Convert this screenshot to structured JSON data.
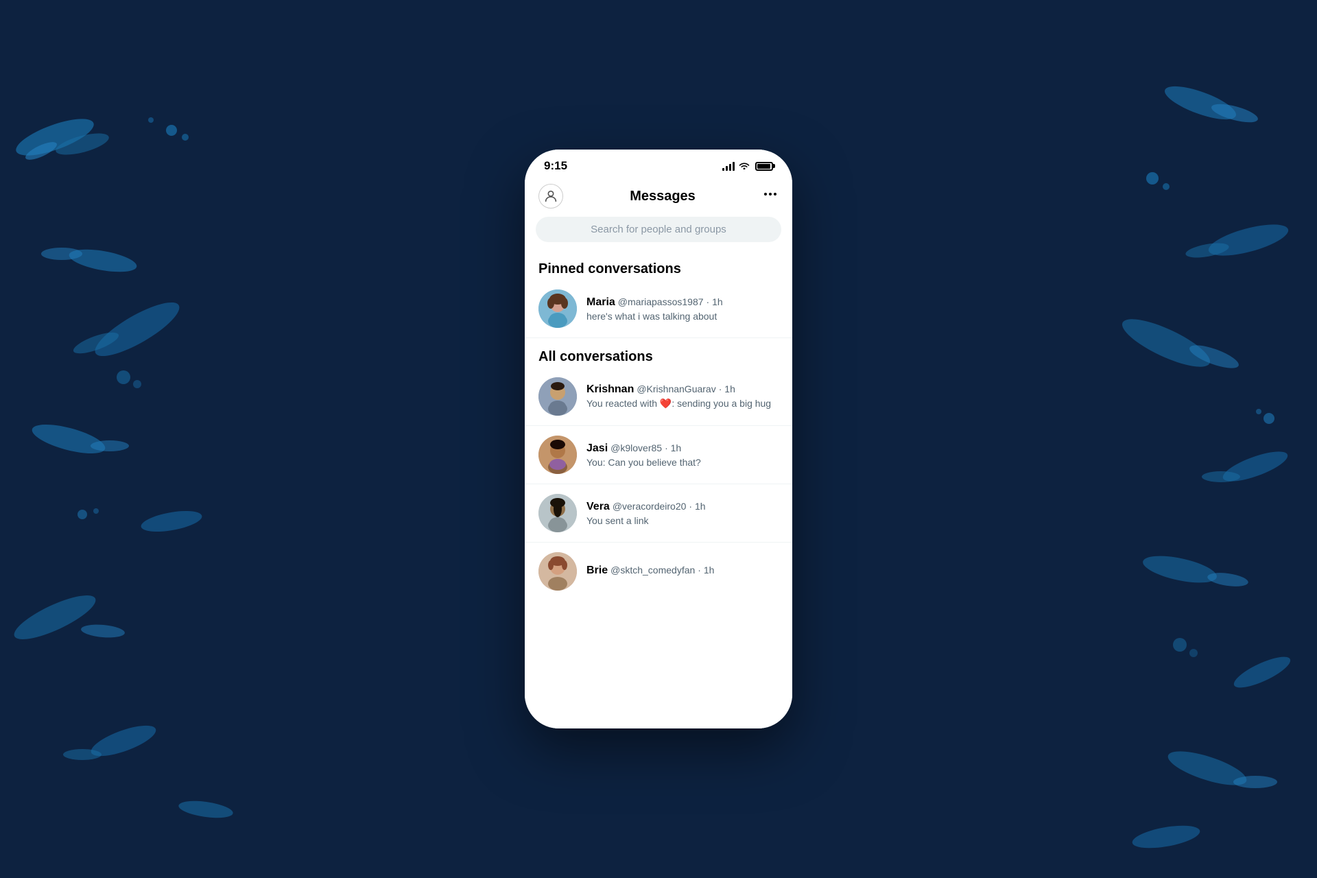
{
  "background": {
    "color": "#0d2240"
  },
  "status_bar": {
    "time": "9:15",
    "signal_label": "signal",
    "wifi_label": "wifi",
    "battery_label": "battery"
  },
  "header": {
    "title": "Messages",
    "more_icon": "•••",
    "avatar_icon": "person"
  },
  "search": {
    "placeholder": "Search for people and groups"
  },
  "pinned_section": {
    "label": "Pinned conversations",
    "items": [
      {
        "name": "Maria",
        "handle": "@mariapassos1987",
        "time": "1h",
        "preview": "here's what i was talking about",
        "avatar_color": "#7eb8d4"
      }
    ]
  },
  "all_section": {
    "label": "All conversations",
    "items": [
      {
        "name": "Krishnan",
        "handle": "@KrishnanGuarav",
        "time": "1h",
        "preview": "You reacted with ❤️: sending you a big hug",
        "avatar_color": "#8fa0b8"
      },
      {
        "name": "Jasi",
        "handle": "@k9lover85",
        "time": "1h",
        "preview": "You: Can you believe that?",
        "avatar_color": "#c4956a"
      },
      {
        "name": "Vera",
        "handle": "@veracordeiro20",
        "time": "1h",
        "preview": "You sent a link",
        "avatar_color": "#b8c4c8"
      },
      {
        "name": "Brie",
        "handle": "@sktch_comedyfan",
        "time": "1h",
        "preview": "",
        "avatar_color": "#d4b8a0"
      }
    ]
  }
}
